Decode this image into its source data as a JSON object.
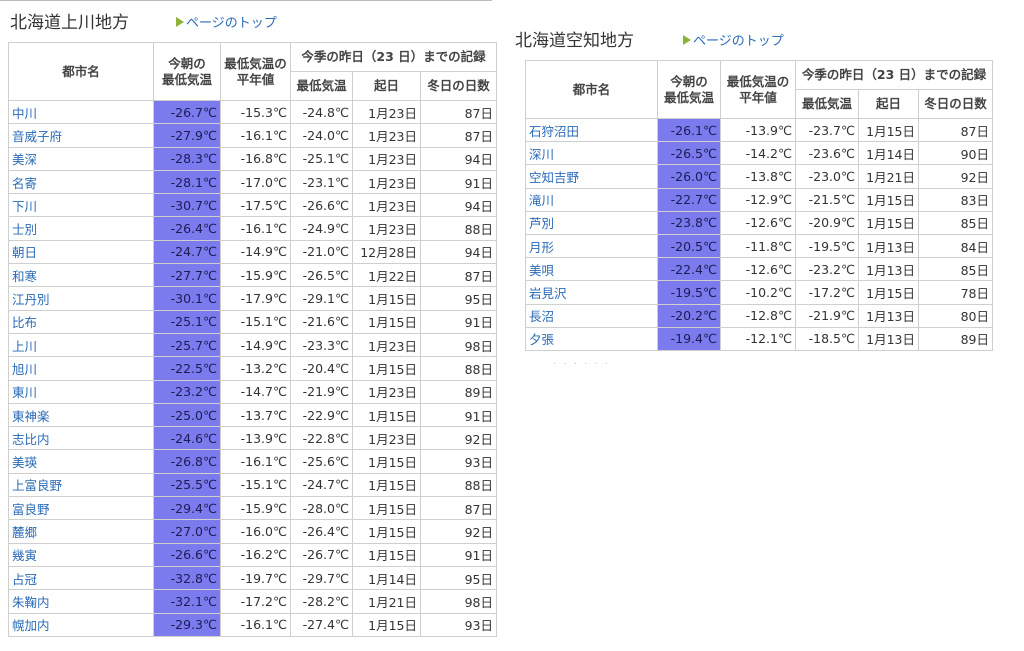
{
  "regions": [
    {
      "title": "北海道上川地方",
      "top_link": "ページのトップ",
      "headers": {
        "city": "都市名",
        "today_min": "今朝の\n最低気温",
        "normal_min": "最低気温の\n平年値",
        "season_group": "今季の昨日（23 日）までの記録",
        "season_min": "最低気温",
        "season_date": "起日",
        "winter_days": "冬日の日数"
      },
      "rows": [
        {
          "city": "中川",
          "today": "-26.7℃",
          "normal": "-15.3℃",
          "season_min": "-24.8℃",
          "date": "1月23日",
          "days": "87日"
        },
        {
          "city": "音威子府",
          "today": "-27.9℃",
          "normal": "-16.1℃",
          "season_min": "-24.0℃",
          "date": "1月23日",
          "days": "87日"
        },
        {
          "city": "美深",
          "today": "-28.3℃",
          "normal": "-16.8℃",
          "season_min": "-25.1℃",
          "date": "1月23日",
          "days": "94日"
        },
        {
          "city": "名寄",
          "today": "-28.1℃",
          "normal": "-17.0℃",
          "season_min": "-23.1℃",
          "date": "1月23日",
          "days": "91日"
        },
        {
          "city": "下川",
          "today": "-30.7℃",
          "normal": "-17.5℃",
          "season_min": "-26.6℃",
          "date": "1月23日",
          "days": "94日"
        },
        {
          "city": "士別",
          "today": "-26.4℃",
          "normal": "-16.1℃",
          "season_min": "-24.9℃",
          "date": "1月23日",
          "days": "88日"
        },
        {
          "city": "朝日",
          "today": "-24.7℃",
          "normal": "-14.9℃",
          "season_min": "-21.0℃",
          "date": "12月28日",
          "days": "94日"
        },
        {
          "city": "和寒",
          "today": "-27.7℃",
          "normal": "-15.9℃",
          "season_min": "-26.5℃",
          "date": "1月22日",
          "days": "87日"
        },
        {
          "city": "江丹別",
          "today": "-30.1℃",
          "normal": "-17.9℃",
          "season_min": "-29.1℃",
          "date": "1月15日",
          "days": "95日"
        },
        {
          "city": "比布",
          "today": "-25.1℃",
          "normal": "-15.1℃",
          "season_min": "-21.6℃",
          "date": "1月15日",
          "days": "91日"
        },
        {
          "city": "上川",
          "today": "-25.7℃",
          "normal": "-14.9℃",
          "season_min": "-23.3℃",
          "date": "1月23日",
          "days": "98日"
        },
        {
          "city": "旭川",
          "today": "-22.5℃",
          "normal": "-13.2℃",
          "season_min": "-20.4℃",
          "date": "1月15日",
          "days": "88日"
        },
        {
          "city": "東川",
          "today": "-23.2℃",
          "normal": "-14.7℃",
          "season_min": "-21.9℃",
          "date": "1月23日",
          "days": "89日"
        },
        {
          "city": "東神楽",
          "today": "-25.0℃",
          "normal": "-13.7℃",
          "season_min": "-22.9℃",
          "date": "1月15日",
          "days": "91日"
        },
        {
          "city": "志比内",
          "today": "-24.6℃",
          "normal": "-13.9℃",
          "season_min": "-22.8℃",
          "date": "1月23日",
          "days": "92日"
        },
        {
          "city": "美瑛",
          "today": "-26.8℃",
          "normal": "-16.1℃",
          "season_min": "-25.6℃",
          "date": "1月15日",
          "days": "93日"
        },
        {
          "city": "上富良野",
          "today": "-25.5℃",
          "normal": "-15.1℃",
          "season_min": "-24.7℃",
          "date": "1月15日",
          "days": "88日"
        },
        {
          "city": "富良野",
          "today": "-29.4℃",
          "normal": "-15.9℃",
          "season_min": "-28.0℃",
          "date": "1月15日",
          "days": "87日"
        },
        {
          "city": "麓郷",
          "today": "-27.0℃",
          "normal": "-16.0℃",
          "season_min": "-26.4℃",
          "date": "1月15日",
          "days": "92日"
        },
        {
          "city": "幾寅",
          "today": "-26.6℃",
          "normal": "-16.2℃",
          "season_min": "-26.7℃",
          "date": "1月15日",
          "days": "91日"
        },
        {
          "city": "占冠",
          "today": "-32.8℃",
          "normal": "-19.7℃",
          "season_min": "-29.7℃",
          "date": "1月14日",
          "days": "95日"
        },
        {
          "city": "朱鞠内",
          "today": "-32.1℃",
          "normal": "-17.2℃",
          "season_min": "-28.2℃",
          "date": "1月21日",
          "days": "98日"
        },
        {
          "city": "幌加内",
          "today": "-29.3℃",
          "normal": "-16.1℃",
          "season_min": "-27.4℃",
          "date": "1月15日",
          "days": "93日"
        }
      ]
    },
    {
      "title": "北海道空知地方",
      "top_link": "ページのトップ",
      "headers": {
        "city": "都市名",
        "today_min": "今朝の\n最低気温",
        "normal_min": "最低気温の\n平年値",
        "season_group": "今季の昨日（23 日）までの記録",
        "season_min": "最低気温",
        "season_date": "起日",
        "winter_days": "冬日の日数"
      },
      "rows": [
        {
          "city": "石狩沼田",
          "today": "-26.1℃",
          "normal": "-13.9℃",
          "season_min": "-23.7℃",
          "date": "1月15日",
          "days": "87日"
        },
        {
          "city": "深川",
          "today": "-26.5℃",
          "normal": "-14.2℃",
          "season_min": "-23.6℃",
          "date": "1月14日",
          "days": "90日"
        },
        {
          "city": "空知吉野",
          "today": "-26.0℃",
          "normal": "-13.8℃",
          "season_min": "-23.0℃",
          "date": "1月21日",
          "days": "92日"
        },
        {
          "city": "滝川",
          "today": "-22.7℃",
          "normal": "-12.9℃",
          "season_min": "-21.5℃",
          "date": "1月15日",
          "days": "83日"
        },
        {
          "city": "芦別",
          "today": "-23.8℃",
          "normal": "-12.6℃",
          "season_min": "-20.9℃",
          "date": "1月15日",
          "days": "85日"
        },
        {
          "city": "月形",
          "today": "-20.5℃",
          "normal": "-11.8℃",
          "season_min": "-19.5℃",
          "date": "1月13日",
          "days": "84日"
        },
        {
          "city": "美唄",
          "today": "-22.4℃",
          "normal": "-12.6℃",
          "season_min": "-23.2℃",
          "date": "1月13日",
          "days": "85日"
        },
        {
          "city": "岩見沢",
          "today": "-19.5℃",
          "normal": "-10.2℃",
          "season_min": "-17.2℃",
          "date": "1月15日",
          "days": "78日"
        },
        {
          "city": "長沼",
          "today": "-20.2℃",
          "normal": "-12.8℃",
          "season_min": "-21.9℃",
          "date": "1月13日",
          "days": "80日"
        },
        {
          "city": "夕張",
          "today": "-19.4℃",
          "normal": "-12.1℃",
          "season_min": "-18.5℃",
          "date": "1月13日",
          "days": "89日"
        }
      ]
    }
  ],
  "colors": {
    "today_highlight": "#7b7bee",
    "city_link": "#2a6bb7",
    "border": "#cfcfcf",
    "arrow": "#8fb23a"
  }
}
